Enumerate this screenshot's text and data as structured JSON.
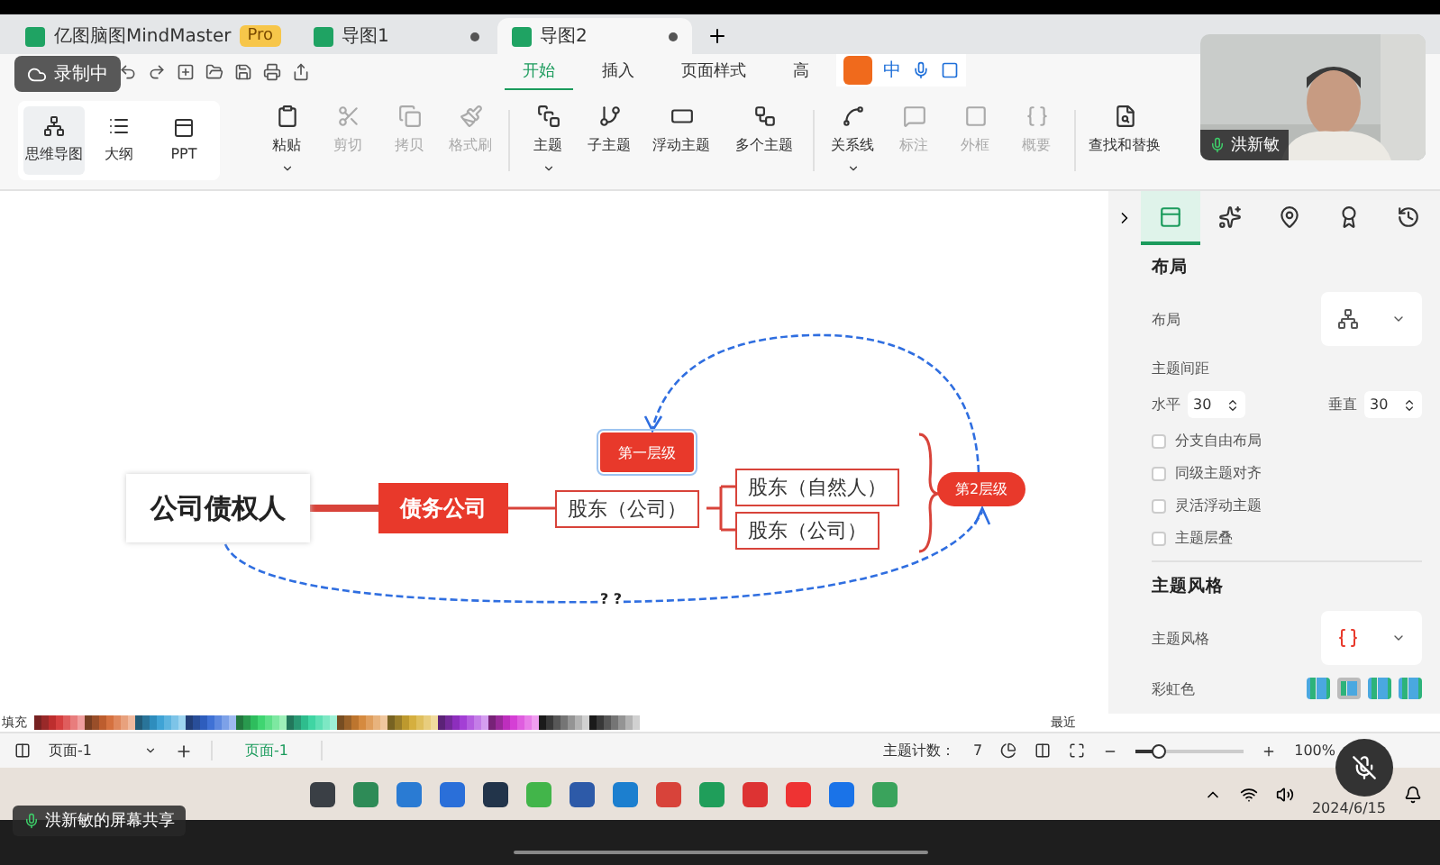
{
  "recording_badge": "录制中",
  "app_tabs": [
    {
      "kind": "app",
      "label": "亿图脑图MindMaster",
      "badge": "Pro",
      "selected": false
    },
    {
      "kind": "doc",
      "label": "导图1",
      "selected": false
    },
    {
      "kind": "doc",
      "label": "导图2",
      "selected": true
    }
  ],
  "menu_tabs": [
    {
      "label": "开始",
      "selected": true
    },
    {
      "label": "插入",
      "selected": false
    },
    {
      "label": "页面样式",
      "selected": false
    },
    {
      "label": "高",
      "selected": false
    }
  ],
  "ime_toolbar": {
    "mode": "中"
  },
  "view_modes": [
    {
      "kind": "mindmap",
      "label": "思维导图",
      "selected": true
    },
    {
      "kind": "outline",
      "label": "大纲",
      "selected": false
    },
    {
      "kind": "ppt",
      "label": "PPT",
      "selected": false
    }
  ],
  "ribbon_tools": [
    {
      "kind": "paste",
      "label": "粘贴",
      "disabled": false,
      "dropdown": true
    },
    {
      "kind": "cut",
      "label": "剪切",
      "disabled": true,
      "dropdown": false
    },
    {
      "kind": "copy",
      "label": "拷贝",
      "disabled": true,
      "dropdown": false
    },
    {
      "kind": "brush",
      "label": "格式刷",
      "disabled": true,
      "dropdown": false
    },
    {
      "kind": "topic",
      "label": "主题",
      "disabled": false,
      "dropdown": true
    },
    {
      "kind": "subtopic",
      "label": "子主题",
      "disabled": false,
      "dropdown": false
    },
    {
      "kind": "float",
      "label": "浮动主题",
      "disabled": false,
      "dropdown": false
    },
    {
      "kind": "multi",
      "label": "多个主题",
      "disabled": false,
      "dropdown": false
    },
    {
      "kind": "relation",
      "label": "关系线",
      "disabled": false,
      "dropdown": true
    },
    {
      "kind": "note",
      "label": "标注",
      "disabled": true,
      "dropdown": false
    },
    {
      "kind": "frame",
      "label": "外框",
      "disabled": true,
      "dropdown": false
    },
    {
      "kind": "summary",
      "label": "概要",
      "disabled": true,
      "dropdown": false
    },
    {
      "kind": "find",
      "label": "查找和替换",
      "disabled": false,
      "dropdown": false
    }
  ],
  "video_tile": {
    "name": "洪新敏"
  },
  "mind_map": {
    "root": "公司债权人",
    "main_topic": "债务公司",
    "subtopic": "股东（公司）",
    "children": [
      {
        "label": "股东（自然人）"
      },
      {
        "label": "股东（公司）"
      }
    ],
    "callout": "第一层级",
    "summary": "第2层级",
    "relationship_label": "? ?"
  },
  "panel_tabs": [
    {
      "kind": "layout",
      "selected": true
    },
    {
      "kind": "sparkle",
      "selected": false
    },
    {
      "kind": "marker",
      "selected": false
    },
    {
      "kind": "badge",
      "selected": false
    },
    {
      "kind": "history",
      "selected": false
    }
  ],
  "layout_section": {
    "heading": "布局",
    "layout_label": "布局",
    "spacing_label": "主题间距",
    "horizontal_label": "水平",
    "horizontal": "30",
    "vertical_label": "垂直",
    "vertical": "30",
    "options": [
      {
        "label": "分支自由布局",
        "checked": false
      },
      {
        "label": "同级主题对齐",
        "checked": false
      },
      {
        "label": "灵活浮动主题",
        "checked": false
      },
      {
        "label": "主题层叠",
        "checked": false
      }
    ]
  },
  "style_section": {
    "heading": "主题风格",
    "style_label": "主题风格",
    "rainbow_label": "彩虹色",
    "swatches": [
      {
        "selected": false
      },
      {
        "selected": true
      },
      {
        "selected": false
      },
      {
        "selected": false
      }
    ]
  },
  "palette": {
    "fill_label": "填充",
    "recent_label": "最近"
  },
  "status_bar": {
    "page_select": "页面-1",
    "pages": [
      {
        "label": "页面-1",
        "selected": true
      }
    ],
    "count_label": "主题计数：",
    "count": "7",
    "zoom": "100%",
    "zoom_slider": {
      "level": 0.22
    }
  },
  "taskbar": {
    "date": "2024/6/15"
  },
  "share_label": "洪新敏的屏幕共享"
}
